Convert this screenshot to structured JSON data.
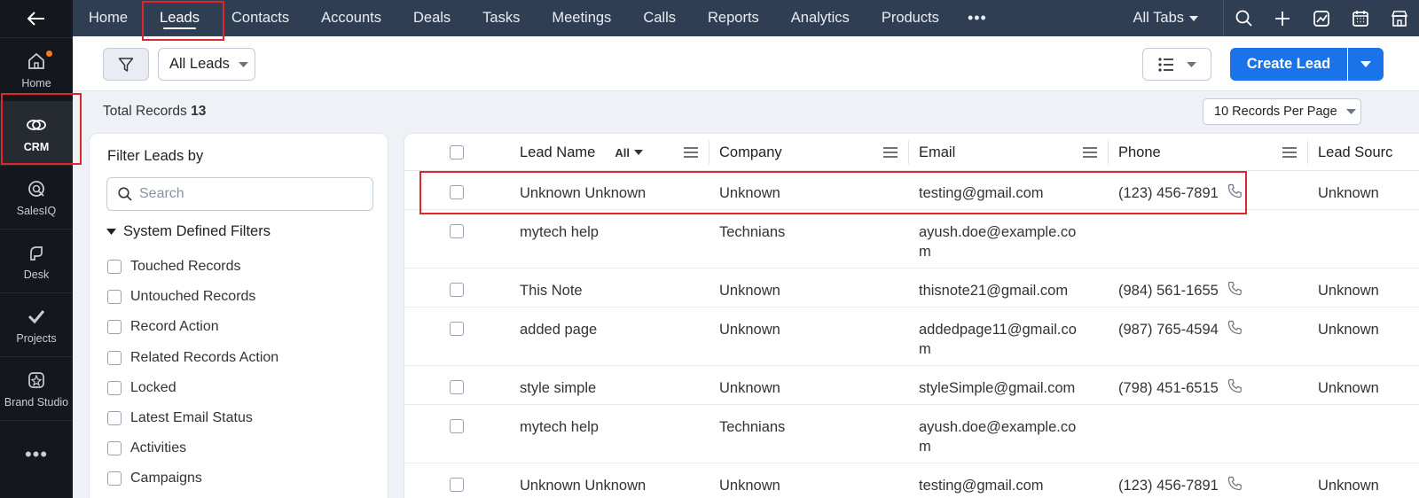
{
  "rail": {
    "items": [
      {
        "label": "Home"
      },
      {
        "label": "CRM"
      },
      {
        "label": "SalesIQ"
      },
      {
        "label": "Desk"
      },
      {
        "label": "Projects"
      },
      {
        "label": "Brand Studio"
      }
    ],
    "more": "•••"
  },
  "topnav": {
    "tabs": [
      "Home",
      "Leads",
      "Contacts",
      "Accounts",
      "Deals",
      "Tasks",
      "Meetings",
      "Calls",
      "Reports",
      "Analytics",
      "Products"
    ],
    "more": "•••",
    "all_tabs": "All Tabs"
  },
  "toolbar": {
    "view": "All Leads",
    "create_label": "Create Lead"
  },
  "records": {
    "total_label": "Total Records",
    "total_count": "13",
    "per_page": "10 Records Per Page"
  },
  "filter_panel": {
    "title": "Filter Leads by",
    "search_placeholder": "Search",
    "section": "System Defined Filters",
    "items": [
      "Touched Records",
      "Untouched Records",
      "Record Action",
      "Related Records Action",
      "Locked",
      "Latest Email Status",
      "Activities",
      "Campaigns"
    ]
  },
  "table": {
    "columns": {
      "lead_name": "Lead Name",
      "lead_name_filter": "All",
      "company": "Company",
      "email": "Email",
      "phone": "Phone",
      "lead_source": "Lead Sourc"
    },
    "rows": [
      {
        "name": "Unknown Unknown",
        "company": "Unknown",
        "email": "testing@gmail.com",
        "phone": "(123) 456-7891",
        "source": "Unknown"
      },
      {
        "name": "mytech help",
        "company": "Technians",
        "email": "ayush.doe@example.com",
        "phone": "",
        "source": ""
      },
      {
        "name": "This Note",
        "company": "Unknown",
        "email": "thisnote21@gmail.com",
        "phone": "(984) 561-1655",
        "source": "Unknown"
      },
      {
        "name": "added page",
        "company": "Unknown",
        "email": "addedpage11@gmail.com",
        "phone": "(987) 765-4594",
        "source": "Unknown"
      },
      {
        "name": "style simple",
        "company": "Unknown",
        "email": "styleSimple@gmail.com",
        "phone": "(798) 451-6515",
        "source": "Unknown"
      },
      {
        "name": "mytech help",
        "company": "Technians",
        "email": "ayush.doe@example.com",
        "phone": "",
        "source": ""
      },
      {
        "name": "Unknown Unknown",
        "company": "Unknown",
        "email": "testing@gmail.com",
        "phone": "(123) 456-7891",
        "source": "Unknown"
      }
    ]
  },
  "colors": {
    "nav_bg": "#2f3e52",
    "rail_bg": "#14171c",
    "accent": "#1a73e8",
    "highlight": "#e0262b"
  }
}
